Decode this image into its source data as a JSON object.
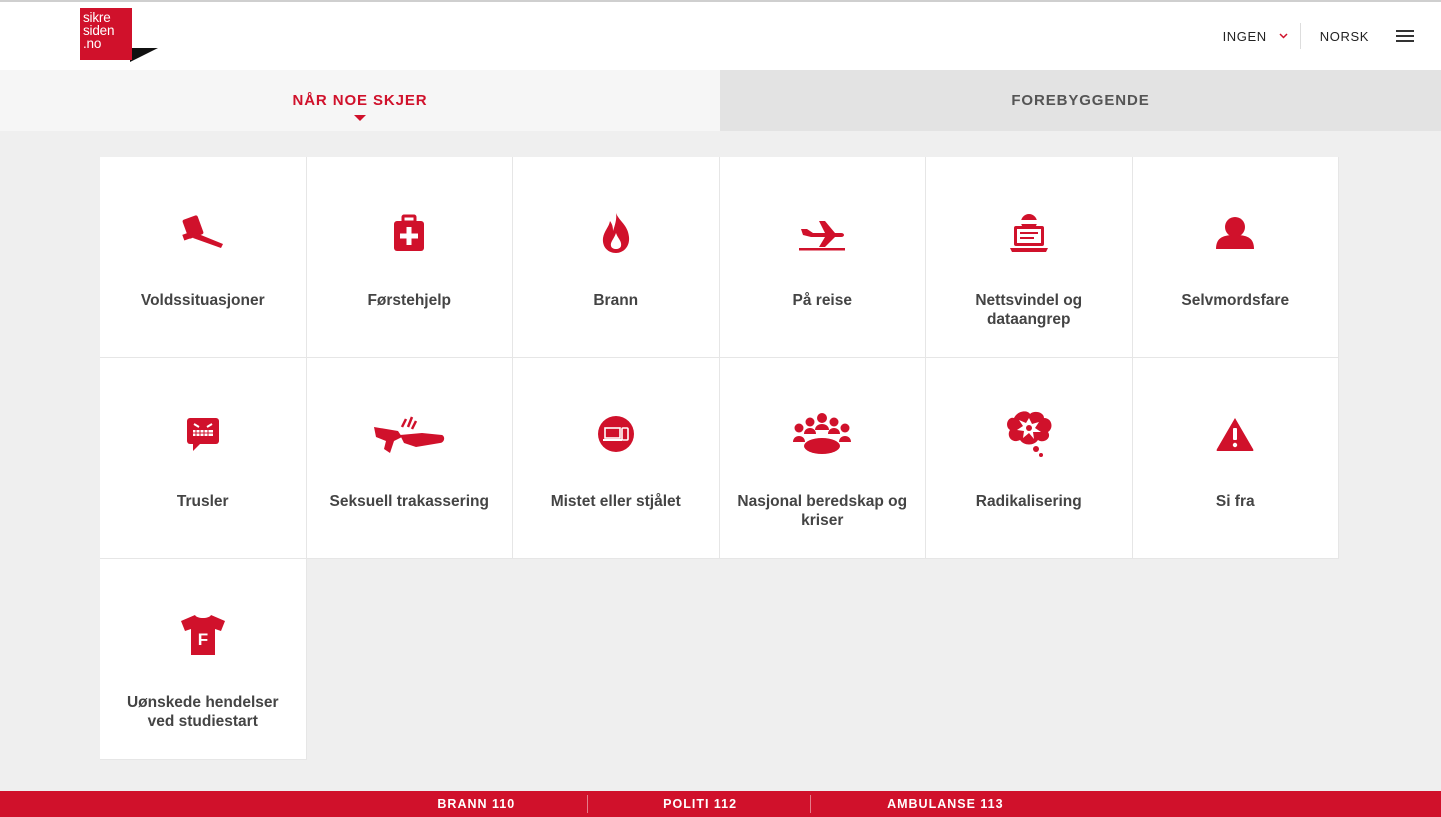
{
  "logo": {
    "line1": "sikre",
    "line2": "siden",
    "line3": ".no",
    "color": "#d0112b"
  },
  "header": {
    "user_label": "INGEN",
    "language_label": "NORSK"
  },
  "tabs": [
    {
      "label": "NÅR NOE SKJER",
      "active": true
    },
    {
      "label": "FOREBYGGENDE",
      "active": false
    }
  ],
  "categories": [
    {
      "label": "Voldssituasjoner",
      "icon": "hammer-icon"
    },
    {
      "label": "Førstehjelp",
      "icon": "first-aid-kit-icon"
    },
    {
      "label": "Brann",
      "icon": "fire-icon"
    },
    {
      "label": "På reise",
      "icon": "airplane-icon"
    },
    {
      "label": "Nettsvindel og dataangrep",
      "icon": "hacker-laptop-icon"
    },
    {
      "label": "Selvmordsfare",
      "icon": "person-icon"
    },
    {
      "label": "Trusler",
      "icon": "angry-speech-bubble-icon"
    },
    {
      "label": "Seksuell trakassering",
      "icon": "hands-touching-icon"
    },
    {
      "label": "Mistet eller stjålet",
      "icon": "devices-icon"
    },
    {
      "label": "Nasjonal beredskap og kriser",
      "icon": "group-table-icon"
    },
    {
      "label": "Radikalisering",
      "icon": "explosion-thought-icon"
    },
    {
      "label": "Si fra",
      "icon": "warning-icon"
    },
    {
      "label": "Uønskede hendelser ved studiestart",
      "icon": "tshirt-icon"
    }
  ],
  "emergency": [
    {
      "label": "BRANN 110"
    },
    {
      "label": "POLITI 112"
    },
    {
      "label": "AMBULANSE 113"
    }
  ],
  "colors": {
    "accent": "#d0112b",
    "background": "#efefef",
    "card": "#ffffff"
  }
}
